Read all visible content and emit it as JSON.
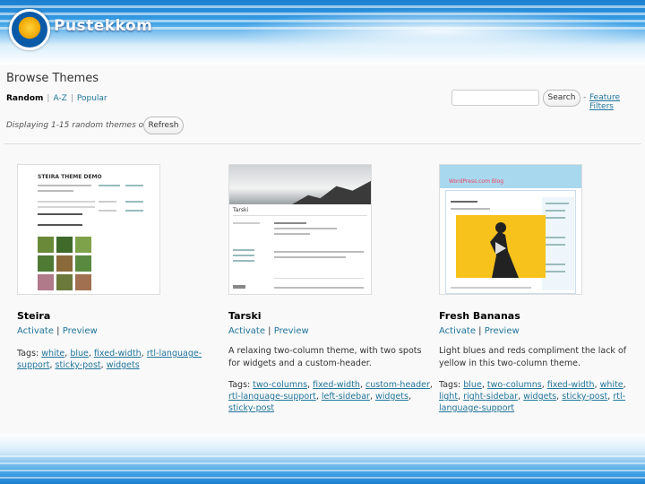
{
  "brand": {
    "logo_text": "Pustekkom"
  },
  "page": {
    "title": "Browse Themes"
  },
  "tabs": [
    {
      "label": "Random",
      "current": true
    },
    {
      "label": "A-Z",
      "current": false
    },
    {
      "label": "Popular",
      "current": false
    }
  ],
  "search": {
    "value": "",
    "placeholder": "",
    "button_label": "Search",
    "feature_filters_label": "Feature Filters"
  },
  "status": {
    "displaying_text": "Displaying 1-15 random themes out of 90",
    "refresh_label": "Refresh"
  },
  "themes": [
    {
      "name": "Steira",
      "activate_label": "Activate",
      "preview_label": "Preview",
      "description": "",
      "tags_label": "Tags:",
      "tags": [
        "white",
        "blue",
        "fixed-width",
        "rtl-language-support",
        "sticky-post",
        "widgets"
      ],
      "thumb": {
        "title": "STEIRA THEME DEMO"
      }
    },
    {
      "name": "Tarski",
      "activate_label": "Activate",
      "preview_label": "Preview",
      "description": "A relaxing two-column theme, with two spots for widgets and a custom-header.",
      "tags_label": "Tags:",
      "tags": [
        "two-columns",
        "fixed-width",
        "custom-header",
        "rtl-language-support",
        "left-sidebar",
        "widgets",
        "sticky-post"
      ],
      "thumb": {
        "title": "Tarski"
      }
    },
    {
      "name": "Fresh Bananas",
      "activate_label": "Activate",
      "preview_label": "Preview",
      "description": "Light blues and reds compliment the lack of yellow in this two-column theme.",
      "tags_label": "Tags:",
      "tags": [
        "blue",
        "two-columns",
        "fixed-width",
        "white",
        "light",
        "right-sidebar",
        "widgets",
        "sticky-post",
        "rtl-language-support"
      ],
      "thumb": {
        "title": "WordPress.com Blog"
      }
    }
  ],
  "colors": {
    "link": "#21759b",
    "banner_blue": "#1a7fd0",
    "panel_bg": "#f9f9f9"
  }
}
